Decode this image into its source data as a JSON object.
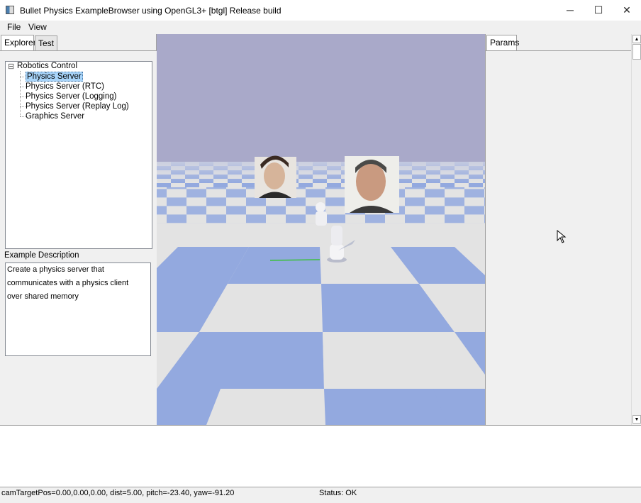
{
  "window": {
    "title": "Bullet Physics ExampleBrowser using OpenGL3+ [btgl] Release build",
    "minimize_glyph": "─",
    "maximize_glyph": "☐",
    "close_glyph": "✕"
  },
  "menu": [
    "File",
    "View"
  ],
  "left_tabs": [
    "Explorer",
    "Test"
  ],
  "tree": {
    "root": "Robotics Control",
    "expander": "⊟",
    "items": [
      "Physics Server",
      "Physics Server (RTC)",
      "Physics Server (Logging)",
      "Physics Server (Replay Log)",
      "Graphics Server"
    ],
    "selected_index": 0
  },
  "description": {
    "label": "Example Description",
    "lines": [
      "Create a physics server that",
      "communicates with a physics client",
      "over shared memory"
    ]
  },
  "params_tab": "Params",
  "status": {
    "camera": "camTargetPos=0.00,0.00,0.00, dist=5.00, pitch=-23.40, yaw=-91.20",
    "state": "Status: OK"
  },
  "colors": {
    "sky": "#a9a9c9",
    "tile_blue": "#93a9df",
    "tile_white": "#e3e3e3",
    "selection": "#a8d4f9"
  }
}
